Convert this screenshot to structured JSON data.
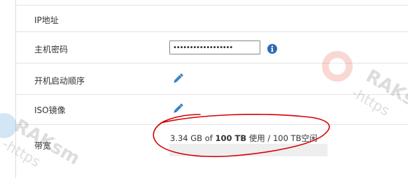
{
  "form": {
    "rows": [
      {
        "label": "IP地址"
      },
      {
        "label": "主机密码"
      },
      {
        "label": "开机启动顺序"
      },
      {
        "label": "ISO镜像"
      },
      {
        "label": "带宽"
      }
    ],
    "password": {
      "value": "••••••••••••••••••"
    },
    "bandwidth": {
      "used": "3.34 GB",
      "of_text": "of",
      "limit_used": "100 TB",
      "used_word": "使用",
      "separator": "/",
      "limit_free": "100 TB",
      "free_word": "空闲",
      "usage_fraction": 3.34e-05
    }
  },
  "watermark": {
    "text": "RAKsm",
    "url_fragment": "-https"
  },
  "colors": {
    "accent": "#2a6eb0",
    "annotation": "#d40000",
    "info": "#2a6eb0",
    "watermark_red": "#e8503c",
    "watermark_blue": "#3a8fd6"
  },
  "icons": {
    "info": "info-circle-icon",
    "edit": "pencil-icon"
  }
}
